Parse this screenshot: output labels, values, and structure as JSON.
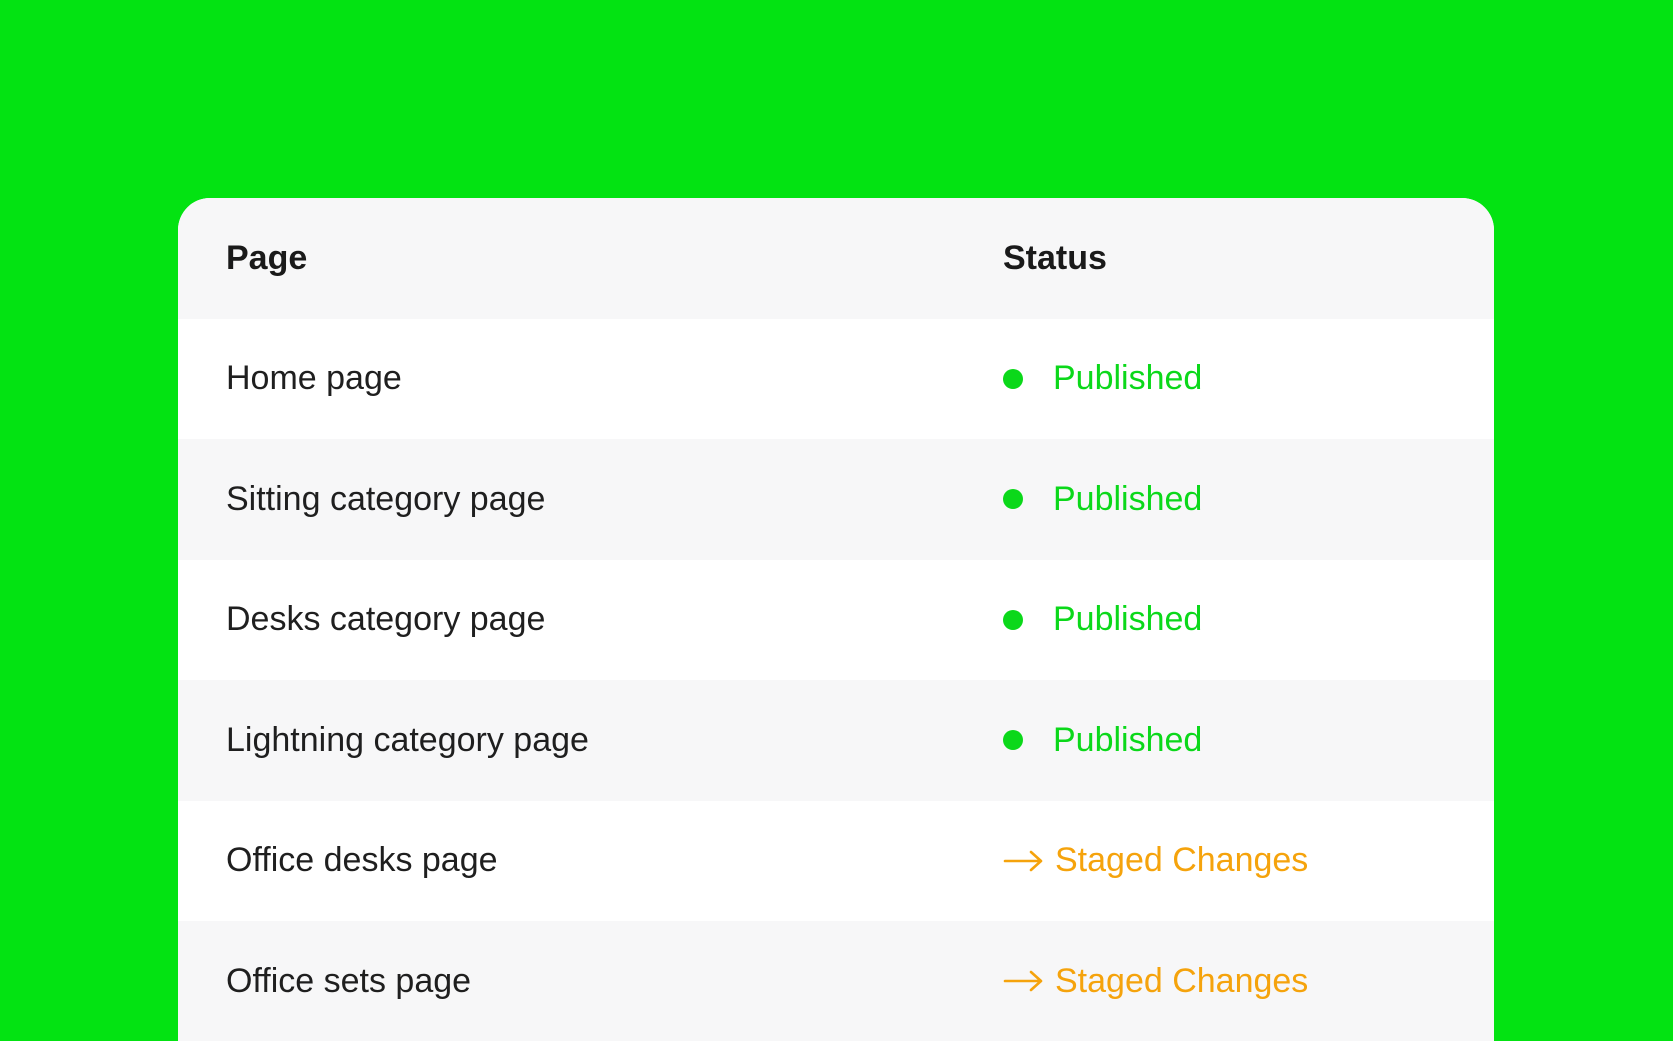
{
  "colors": {
    "background": "#03e312",
    "published": "#0bd81a",
    "staged": "#f5a30c",
    "text": "#1f1f1f"
  },
  "table": {
    "headers": {
      "page": "Page",
      "status": "Status"
    },
    "rows": [
      {
        "page": "Home page",
        "status": "Published",
        "status_type": "published",
        "icon": "status-dot-icon"
      },
      {
        "page": "Sitting category page",
        "status": "Published",
        "status_type": "published",
        "icon": "status-dot-icon"
      },
      {
        "page": "Desks category page",
        "status": "Published",
        "status_type": "published",
        "icon": "status-dot-icon"
      },
      {
        "page": "Lightning category page",
        "status": "Published",
        "status_type": "published",
        "icon": "status-dot-icon"
      },
      {
        "page": "Office desks page",
        "status": "Staged Changes",
        "status_type": "staged",
        "icon": "arrow-right-icon"
      },
      {
        "page": "Office sets page",
        "status": "Staged Changes",
        "status_type": "staged",
        "icon": "arrow-right-icon"
      }
    ]
  }
}
